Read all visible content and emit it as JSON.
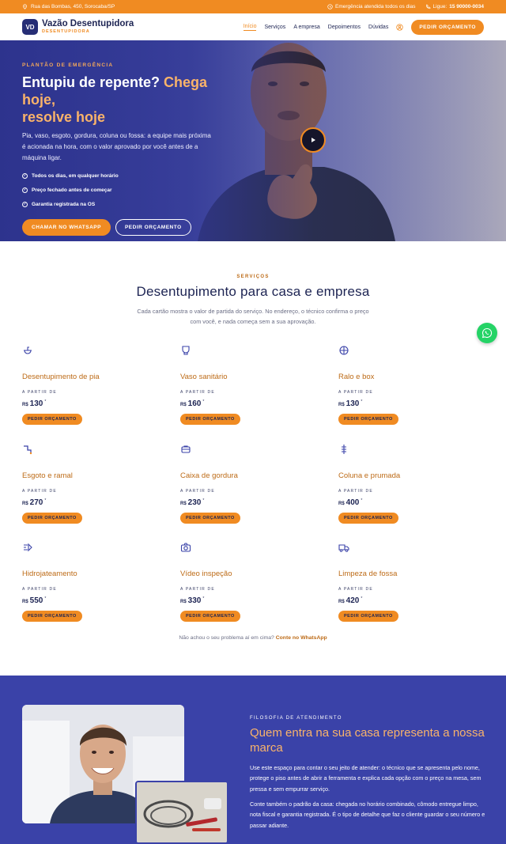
{
  "topbar": {
    "address": "Rua das Bombas, 450, Sorocaba/SP",
    "emergency": "Emergência atendida todos os dias",
    "call_label": "Ligue:",
    "phone": "15 90000-0034"
  },
  "header": {
    "logo_initials": "VD",
    "brand_name": "Vazão Desentupidora",
    "brand_sub": "DESENTUPIDORA",
    "nav": [
      "Início",
      "Serviços",
      "A empresa",
      "Depoimentos",
      "Dúvidas"
    ],
    "cta": "PEDIR ORÇAMENTO"
  },
  "hero": {
    "eyebrow": "PLANTÃO DE EMERGÊNCIA",
    "title_main": "Entupiu de repente?",
    "title_accent_1": "Chega hoje,",
    "title_accent_2": "resolve hoje",
    "paragraph": "Pia, vaso, esgoto, gordura, coluna ou fossa: a equipe mais próxima é acionada na hora, com o valor aprovado por você antes de a máquina ligar.",
    "checks": [
      "Todos os dias, em qualquer horário",
      "Preço fechado antes de começar",
      "Garantia registrada na OS"
    ],
    "btn_whatsapp": "CHAMAR NO WHATSAPP",
    "btn_quote": "PEDIR ORÇAMENTO"
  },
  "services": {
    "eyebrow": "SERVIÇOS",
    "title": "Desentupimento para casa e empresa",
    "subtitle_1": "Cada cartão mostra o valor de partida do serviço. No endereço, o técnico confirma o preço",
    "subtitle_2": "com você, e nada começa sem a sua aprovação.",
    "from_label": "A PARTIR DE",
    "currency": "R$",
    "price_mark": "*",
    "card_button": "PEDIR ORÇAMENTO",
    "items": [
      {
        "name": "Desentupimento de pia",
        "price": "130",
        "icon": "sink-icon"
      },
      {
        "name": "Vaso sanitário",
        "price": "160",
        "icon": "toilet-icon"
      },
      {
        "name": "Ralo e box",
        "price": "130",
        "icon": "drain-icon"
      },
      {
        "name": "Esgoto e ramal",
        "price": "270",
        "icon": "pipe-icon"
      },
      {
        "name": "Caixa de gordura",
        "price": "230",
        "icon": "box-icon"
      },
      {
        "name": "Coluna e prumada",
        "price": "400",
        "icon": "column-icon"
      },
      {
        "name": "Hidrojateamento",
        "price": "550",
        "icon": "jet-icon"
      },
      {
        "name": "Vídeo inspeção",
        "price": "330",
        "icon": "camera-icon"
      },
      {
        "name": "Limpeza de fossa",
        "price": "420",
        "icon": "truck-icon"
      }
    ],
    "footer_text": "Não achou o seu problema aí em cima?",
    "footer_link": "Conte no WhatsApp"
  },
  "about": {
    "eyebrow": "FILOSOFIA DE ATENDIMENTO",
    "title": "Quem entra na sua casa representa a nossa marca",
    "p1": "Use este espaço para contar o seu jeito de atender: o técnico que se apresenta pelo nome, protege o piso antes de abrir a ferramenta e explica cada opção com o preço na mesa, sem pressa e sem empurrar serviço.",
    "p2": "Conte também o padrão da casa: chegada no horário combinado, cômodo entregue limpo, nota fiscal e garantia registrada. É o tipo de detalhe que faz o cliente guardar o seu número e passar adiante."
  },
  "colors": {
    "orange": "#f08b22",
    "navy": "#1d2453",
    "blue": "#3a42a8",
    "whatsapp": "#25d366"
  }
}
